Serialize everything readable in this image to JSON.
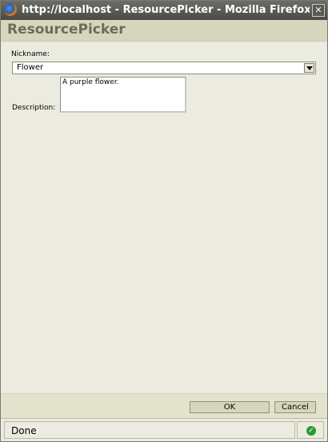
{
  "window": {
    "title": "http://localhost - ResourcePicker - Mozilla Firefox",
    "close_glyph": "✕"
  },
  "header": {
    "title": "ResourcePicker"
  },
  "form": {
    "nickname_label": "Nickname:",
    "nickname_value": "Flower",
    "description_label": "Description:",
    "description_value": "A purple flower."
  },
  "footer": {
    "ok_label": "OK",
    "cancel_label": "Cancel"
  },
  "status": {
    "text": "Done",
    "security_glyph": "✓"
  },
  "icons": {
    "app": "firefox-icon",
    "close": "close-icon",
    "dropdown": "chevron-down-icon",
    "security": "check-icon"
  },
  "colors": {
    "header_bg": "#d7d6bd",
    "title_text": "#6d6c55",
    "body_bg": "#ecebdf",
    "status_ok": "#2c9b2c"
  }
}
